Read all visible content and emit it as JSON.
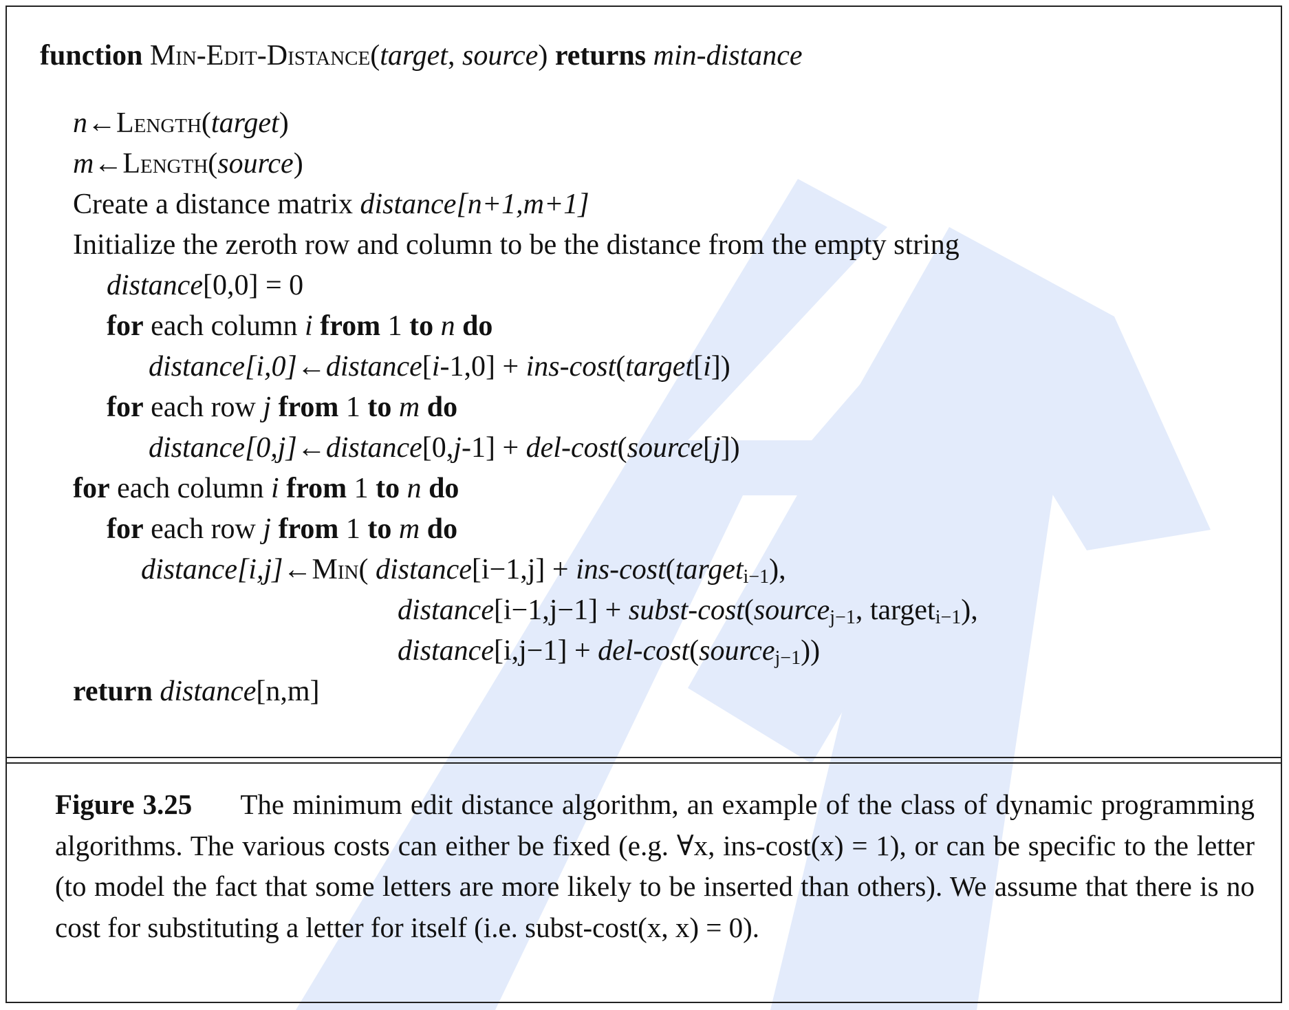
{
  "algorithm": {
    "header": {
      "kw_function": "function",
      "name": "Min-Edit-Distance",
      "open_paren": "(",
      "param1": "target",
      "comma": ", ",
      "param2": "source",
      "close_paren": ")",
      "kw_returns": "returns",
      "return_value": "min-distance"
    },
    "line_n": {
      "var": "n",
      "arrow": "←",
      "func": "Length",
      "open": "(",
      "arg": "target",
      "close": ")"
    },
    "line_m": {
      "var": "m",
      "arrow": "←",
      "func": "Length",
      "open": "(",
      "arg": "source",
      "close": ")"
    },
    "line_create": {
      "text": "Create a distance matrix ",
      "matrix": "distance[n+1,m+1]"
    },
    "line_init": {
      "text": "Initialize the zeroth row and column to be the distance from the empty string"
    },
    "line_d00": {
      "var": "distance",
      "rest": "[0,0] = 0"
    },
    "loop1": {
      "kw_for": "for",
      "t1": " each column ",
      "v1": "i",
      "kw_from": "from",
      "t2": " 1 ",
      "kw_to": "to",
      "v2": "n",
      "kw_do": "do"
    },
    "loop1_body": {
      "lhs": "distance[i,0]",
      "arrow": "←",
      "d": "distance",
      "idx": "[",
      "idx_i": "i",
      "idx_rest": "-1,0] + ",
      "cost": "ins-cost",
      "open": "(",
      "arg": "target",
      "b1": "[",
      "ai": "i",
      "b2": "])"
    },
    "loop2": {
      "kw_for": "for",
      "t1": " each row ",
      "v1": "j",
      "kw_from": "from",
      "t2": " 1 ",
      "kw_to": "to",
      "v2": "m",
      "kw_do": "do"
    },
    "loop2_body": {
      "lhs": "distance[0,j]",
      "arrow": "←",
      "d": "distance",
      "idx": "[0,",
      "idx_j": "j",
      "idx_rest": "-1] + ",
      "cost": "del-cost",
      "open": "(",
      "arg": "source",
      "b1": "[",
      "aj": "j",
      "b2": "])"
    },
    "loop3": {
      "kw_for": "for",
      "t1": " each column ",
      "v1": "i",
      "kw_from": "from",
      "t2": " 1 ",
      "kw_to": "to",
      "v2": "n",
      "kw_do": "do"
    },
    "loop4": {
      "kw_for": "for",
      "t1": " each row ",
      "v1": "j",
      "kw_from": "from",
      "t2": " 1 ",
      "kw_to": "to",
      "v2": "m",
      "kw_do": "do"
    },
    "min_line1": {
      "lhs": "distance[i,j]",
      "arrow": "←",
      "func": "Min",
      "open": "( ",
      "d": "distance",
      "idx": "[i−1,j] + ",
      "cost": "ins-cost",
      "arg_open": "(",
      "arg": "target",
      "sub": "i−1",
      "close": "),"
    },
    "min_line2": {
      "d": "distance",
      "idx": "[i−1,j−1] + ",
      "cost": "subst-cost",
      "arg_open": "(",
      "arg1": "source",
      "sub1": "j−1",
      "sep": ", target",
      "sub2": "i−1",
      "close": "),"
    },
    "min_line3": {
      "d": "distance",
      "idx": "[i,j−1] + ",
      "cost": "del-cost",
      "arg_open": "(",
      "arg": "source",
      "sub": "j−1",
      "close": "))"
    },
    "return_line": {
      "kw_return": "return",
      "d": "distance",
      "rest": "[n,m]"
    }
  },
  "caption": {
    "label": "Figure 3.25",
    "text": "The minimum edit distance algorithm, an example of the class of dynamic programming algorithms. The various costs can either be fixed (e.g. ∀x, ins-cost(x) = 1), or can be specific to the letter (to model the fact that some letters are more likely to be inserted than others). We assume that there is no cost for substituting a letter for itself (i.e. subst-cost(x, x) = 0)."
  },
  "colors": {
    "watermark": "#e3ebfb",
    "ink": "#111111",
    "border": "#222222"
  }
}
